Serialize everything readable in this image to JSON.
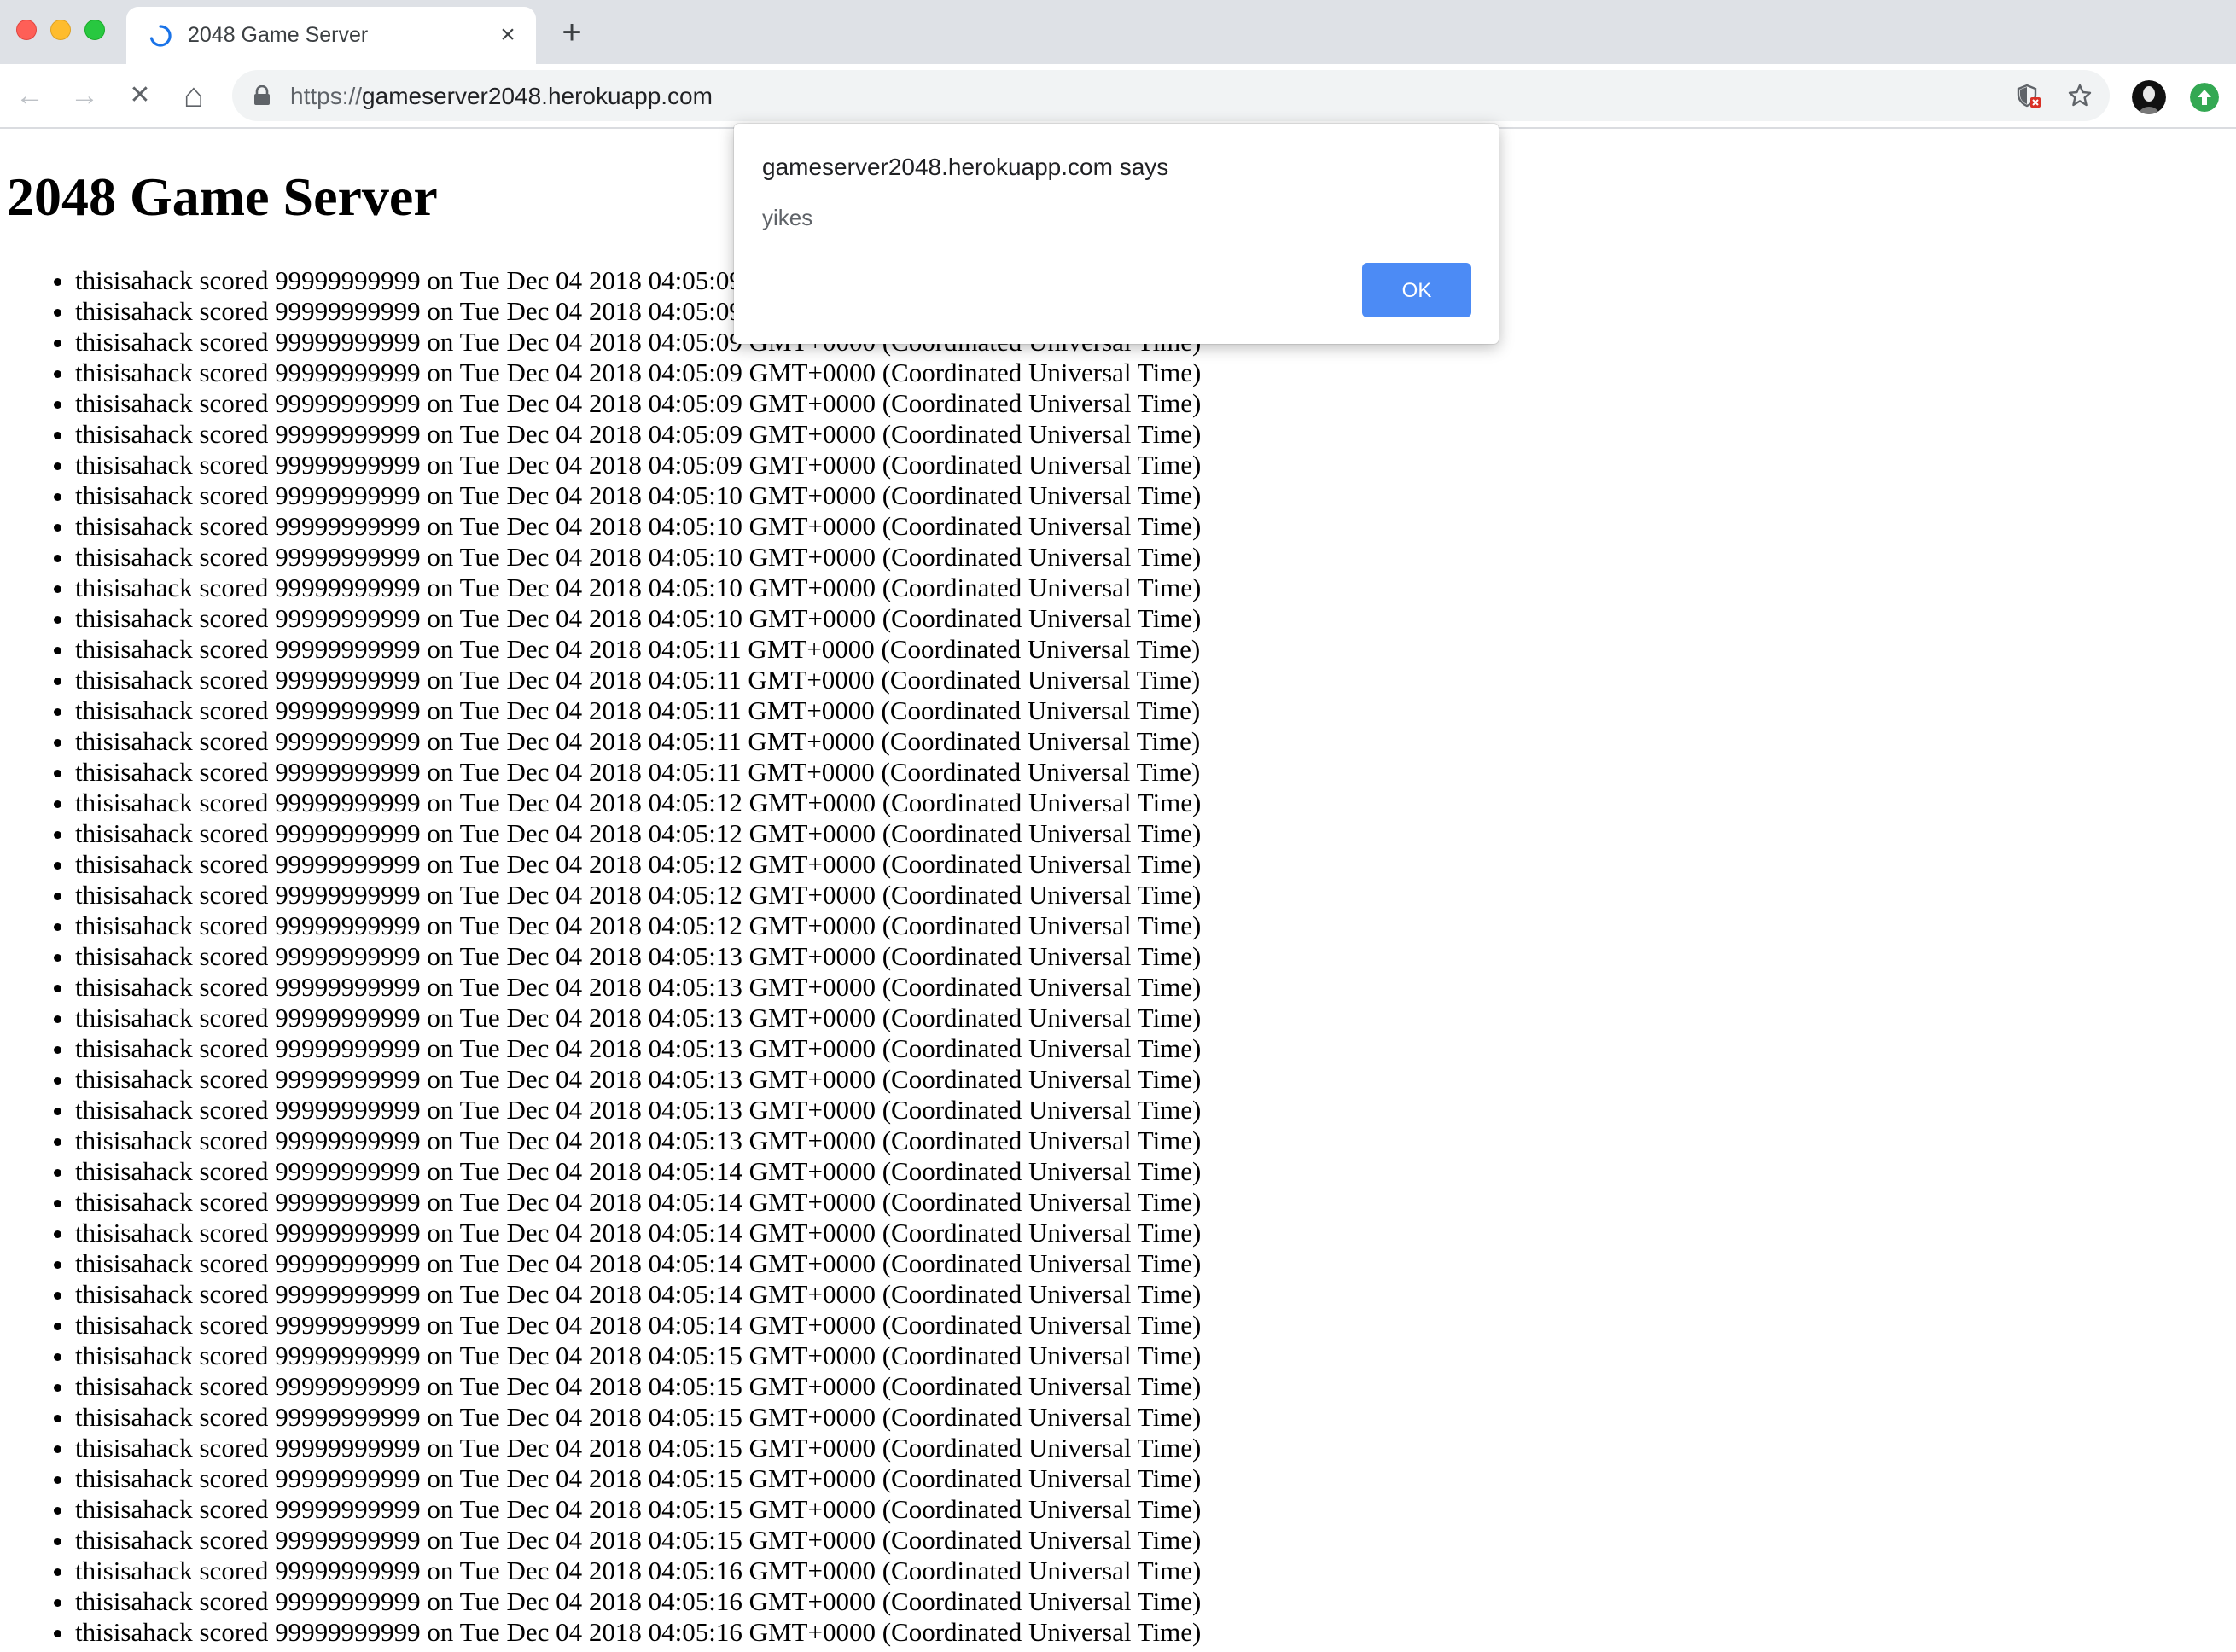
{
  "browser": {
    "tab": {
      "title": "2048 Game Server",
      "close_glyph": "×"
    },
    "new_tab_glyph": "+",
    "toolbar": {
      "back_glyph": "←",
      "forward_glyph": "→",
      "stop_glyph": "✕",
      "home_glyph": "⌂",
      "url_scheme": "https://",
      "url_host": "gameserver2048.herokuapp.com"
    }
  },
  "page": {
    "heading": "2048 Game Server",
    "scores": [
      "thisisahack scored 99999999999 on Tue Dec 04 2018 04:05:09 GMT+0000 (Coordinated Universal Time)",
      "thisisahack scored 99999999999 on Tue Dec 04 2018 04:05:09 GMT+0000 (Coordinated Universal Time)",
      "thisisahack scored 99999999999 on Tue Dec 04 2018 04:05:09 GMT+0000 (Coordinated Universal Time)",
      "thisisahack scored 99999999999 on Tue Dec 04 2018 04:05:09 GMT+0000 (Coordinated Universal Time)",
      "thisisahack scored 99999999999 on Tue Dec 04 2018 04:05:09 GMT+0000 (Coordinated Universal Time)",
      "thisisahack scored 99999999999 on Tue Dec 04 2018 04:05:09 GMT+0000 (Coordinated Universal Time)",
      "thisisahack scored 99999999999 on Tue Dec 04 2018 04:05:09 GMT+0000 (Coordinated Universal Time)",
      "thisisahack scored 99999999999 on Tue Dec 04 2018 04:05:10 GMT+0000 (Coordinated Universal Time)",
      "thisisahack scored 99999999999 on Tue Dec 04 2018 04:05:10 GMT+0000 (Coordinated Universal Time)",
      "thisisahack scored 99999999999 on Tue Dec 04 2018 04:05:10 GMT+0000 (Coordinated Universal Time)",
      "thisisahack scored 99999999999 on Tue Dec 04 2018 04:05:10 GMT+0000 (Coordinated Universal Time)",
      "thisisahack scored 99999999999 on Tue Dec 04 2018 04:05:10 GMT+0000 (Coordinated Universal Time)",
      "thisisahack scored 99999999999 on Tue Dec 04 2018 04:05:11 GMT+0000 (Coordinated Universal Time)",
      "thisisahack scored 99999999999 on Tue Dec 04 2018 04:05:11 GMT+0000 (Coordinated Universal Time)",
      "thisisahack scored 99999999999 on Tue Dec 04 2018 04:05:11 GMT+0000 (Coordinated Universal Time)",
      "thisisahack scored 99999999999 on Tue Dec 04 2018 04:05:11 GMT+0000 (Coordinated Universal Time)",
      "thisisahack scored 99999999999 on Tue Dec 04 2018 04:05:11 GMT+0000 (Coordinated Universal Time)",
      "thisisahack scored 99999999999 on Tue Dec 04 2018 04:05:12 GMT+0000 (Coordinated Universal Time)",
      "thisisahack scored 99999999999 on Tue Dec 04 2018 04:05:12 GMT+0000 (Coordinated Universal Time)",
      "thisisahack scored 99999999999 on Tue Dec 04 2018 04:05:12 GMT+0000 (Coordinated Universal Time)",
      "thisisahack scored 99999999999 on Tue Dec 04 2018 04:05:12 GMT+0000 (Coordinated Universal Time)",
      "thisisahack scored 99999999999 on Tue Dec 04 2018 04:05:12 GMT+0000 (Coordinated Universal Time)",
      "thisisahack scored 99999999999 on Tue Dec 04 2018 04:05:13 GMT+0000 (Coordinated Universal Time)",
      "thisisahack scored 99999999999 on Tue Dec 04 2018 04:05:13 GMT+0000 (Coordinated Universal Time)",
      "thisisahack scored 99999999999 on Tue Dec 04 2018 04:05:13 GMT+0000 (Coordinated Universal Time)",
      "thisisahack scored 99999999999 on Tue Dec 04 2018 04:05:13 GMT+0000 (Coordinated Universal Time)",
      "thisisahack scored 99999999999 on Tue Dec 04 2018 04:05:13 GMT+0000 (Coordinated Universal Time)",
      "thisisahack scored 99999999999 on Tue Dec 04 2018 04:05:13 GMT+0000 (Coordinated Universal Time)",
      "thisisahack scored 99999999999 on Tue Dec 04 2018 04:05:13 GMT+0000 (Coordinated Universal Time)",
      "thisisahack scored 99999999999 on Tue Dec 04 2018 04:05:14 GMT+0000 (Coordinated Universal Time)",
      "thisisahack scored 99999999999 on Tue Dec 04 2018 04:05:14 GMT+0000 (Coordinated Universal Time)",
      "thisisahack scored 99999999999 on Tue Dec 04 2018 04:05:14 GMT+0000 (Coordinated Universal Time)",
      "thisisahack scored 99999999999 on Tue Dec 04 2018 04:05:14 GMT+0000 (Coordinated Universal Time)",
      "thisisahack scored 99999999999 on Tue Dec 04 2018 04:05:14 GMT+0000 (Coordinated Universal Time)",
      "thisisahack scored 99999999999 on Tue Dec 04 2018 04:05:14 GMT+0000 (Coordinated Universal Time)",
      "thisisahack scored 99999999999 on Tue Dec 04 2018 04:05:15 GMT+0000 (Coordinated Universal Time)",
      "thisisahack scored 99999999999 on Tue Dec 04 2018 04:05:15 GMT+0000 (Coordinated Universal Time)",
      "thisisahack scored 99999999999 on Tue Dec 04 2018 04:05:15 GMT+0000 (Coordinated Universal Time)",
      "thisisahack scored 99999999999 on Tue Dec 04 2018 04:05:15 GMT+0000 (Coordinated Universal Time)",
      "thisisahack scored 99999999999 on Tue Dec 04 2018 04:05:15 GMT+0000 (Coordinated Universal Time)",
      "thisisahack scored 99999999999 on Tue Dec 04 2018 04:05:15 GMT+0000 (Coordinated Universal Time)",
      "thisisahack scored 99999999999 on Tue Dec 04 2018 04:05:15 GMT+0000 (Coordinated Universal Time)",
      "thisisahack scored 99999999999 on Tue Dec 04 2018 04:05:16 GMT+0000 (Coordinated Universal Time)",
      "thisisahack scored 99999999999 on Tue Dec 04 2018 04:05:16 GMT+0000 (Coordinated Universal Time)",
      "thisisahack scored 99999999999 on Tue Dec 04 2018 04:05:16 GMT+0000 (Coordinated Universal Time)"
    ]
  },
  "dialog": {
    "title": "gameserver2048.herokuapp.com says",
    "message": "yikes",
    "ok_label": "OK"
  },
  "colors": {
    "ok_button": "#4c8bf5",
    "tab_spinner": "#1a73e8",
    "extension_green": "#34a853"
  },
  "icons": {
    "tab_spinner": "loading-spinner-icon",
    "lock": "lock-icon",
    "shield": "shield-blocked-icon",
    "star": "bookmark-star-icon",
    "profile": "profile-avatar-icon",
    "extension": "upload-arrow-icon"
  }
}
